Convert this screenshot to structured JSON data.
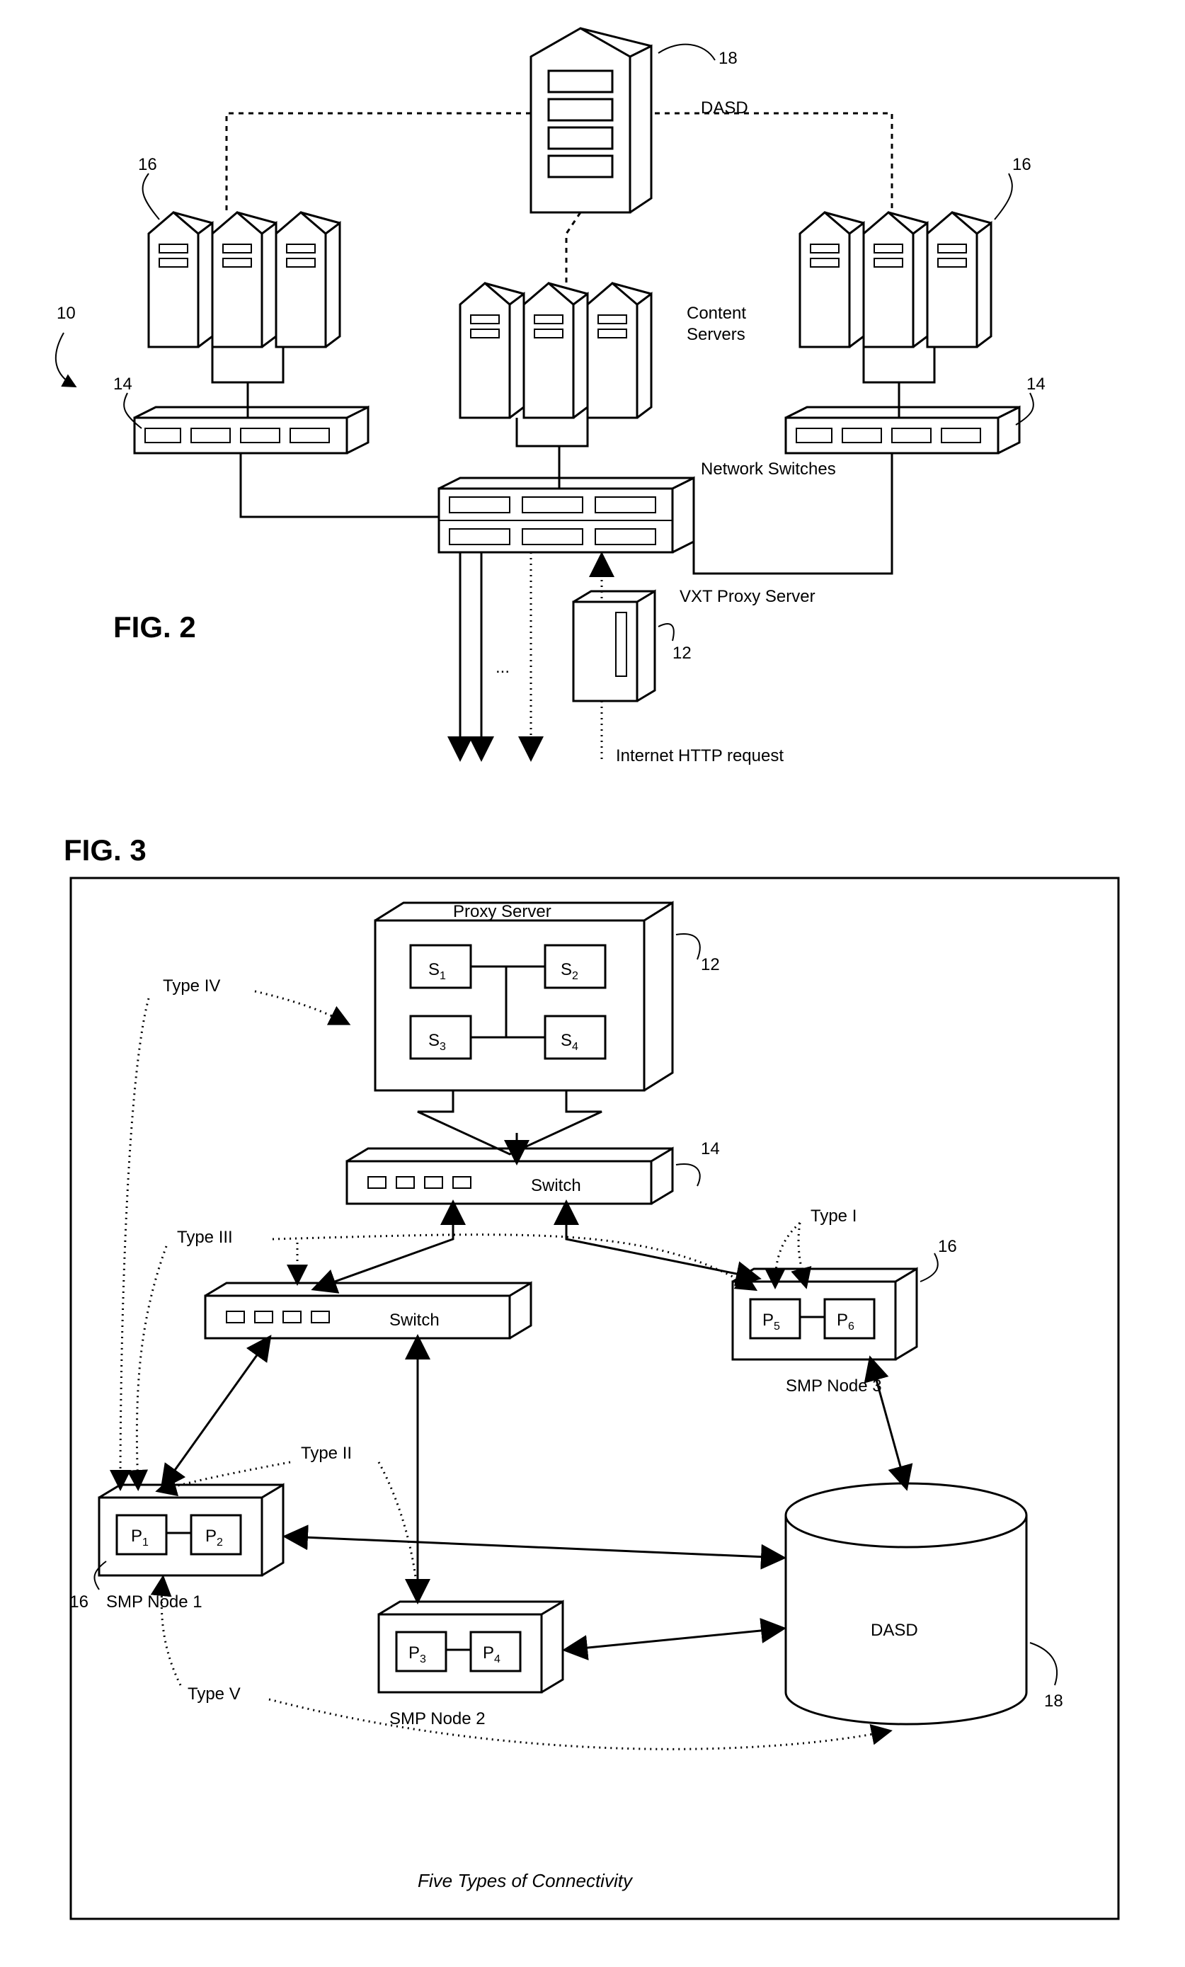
{
  "fig2": {
    "title": "FIG. 2",
    "refs": {
      "system": "10",
      "proxy": "12",
      "switch_l": "14",
      "switch_r": "14",
      "servers_l": "16",
      "servers_r": "16",
      "dasd": "18"
    },
    "labels": {
      "dasd": "DASD",
      "content_servers_l1": "Content",
      "content_servers_l2": "Servers",
      "network_switches": "Network Switches",
      "vxt_proxy": "VXT Proxy Server",
      "http_request": "Internet HTTP request"
    }
  },
  "fig3": {
    "title": "FIG. 3",
    "caption": "Five Types of Connectivity",
    "refs": {
      "proxy": "12",
      "switch": "14",
      "node1": "16",
      "node3": "16",
      "dasd": "18"
    },
    "labels": {
      "proxy_title": "Proxy Server",
      "switch": "Switch",
      "smp1": "SMP Node 1",
      "smp2": "SMP Node 2",
      "smp3": "SMP Node 3",
      "dasd": "DASD",
      "t1": "Type I",
      "t2": "Type II",
      "t3": "Type III",
      "t4": "Type IV",
      "t5": "Type V"
    },
    "proxy_servers": {
      "s1": "S",
      "s1n": "1",
      "s2": "S",
      "s2n": "2",
      "s3": "S",
      "s3n": "3",
      "s4": "S",
      "s4n": "4"
    },
    "nodes": {
      "n1": {
        "p1": "P",
        "p1n": "1",
        "p2": "P",
        "p2n": "2"
      },
      "n2": {
        "p3": "P",
        "p3n": "3",
        "p4": "P",
        "p4n": "4"
      },
      "n3": {
        "p5": "P",
        "p5n": "5",
        "p6": "P",
        "p6n": "6"
      }
    }
  }
}
